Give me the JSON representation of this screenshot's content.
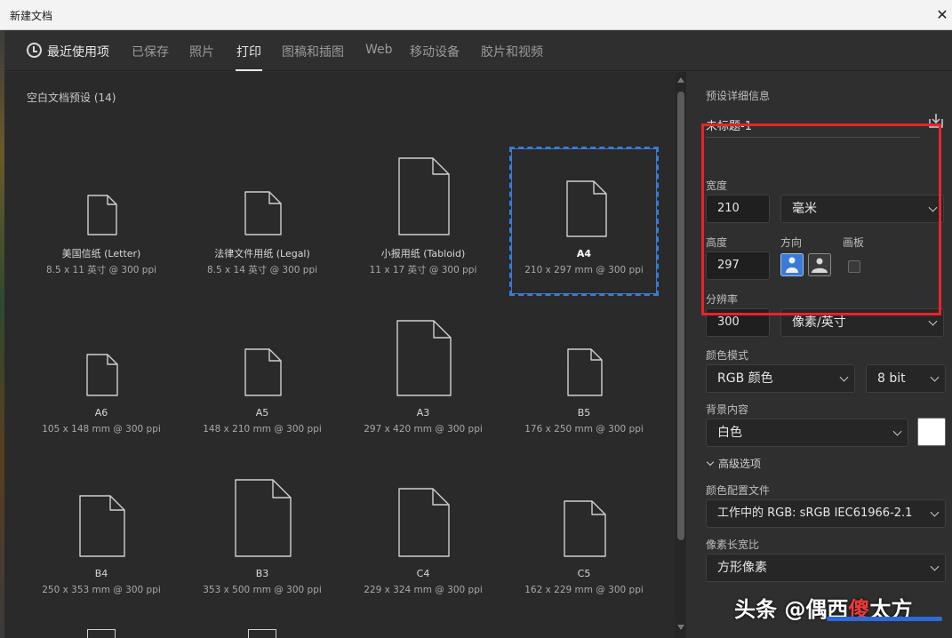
{
  "window": {
    "title": "新建文档",
    "close_glyph": "✕"
  },
  "tabs": [
    {
      "label": "最近使用项",
      "icon": "clock-icon"
    },
    {
      "label": "已保存"
    },
    {
      "label": "照片"
    },
    {
      "label": "打印",
      "active": true
    },
    {
      "label": "图稿和插图"
    },
    {
      "label": "Web"
    },
    {
      "label": "移动设备"
    },
    {
      "label": "胶片和视频"
    }
  ],
  "presets_panel": {
    "header": "空白文档预设 (14)",
    "items": [
      {
        "name": "美国信纸 (Letter)",
        "dims": "8.5 x 11 英寸 @ 300 ppi"
      },
      {
        "name": "法律文件用纸 (Legal)",
        "dims": "8.5 x 14 英寸 @ 300 ppi"
      },
      {
        "name": "小报用纸 (Tabloid)",
        "dims": "11 x 17 英寸 @ 300 ppi"
      },
      {
        "name": "A4",
        "dims": "210 x 297 mm @ 300 ppi",
        "selected": true
      },
      {
        "name": "A6",
        "dims": "105 x 148 mm @ 300 ppi"
      },
      {
        "name": "A5",
        "dims": "148 x 210 mm @ 300 ppi"
      },
      {
        "name": "A3",
        "dims": "297 x 420 mm @ 300 ppi"
      },
      {
        "name": "B5",
        "dims": "176 x 250 mm @ 300 ppi"
      },
      {
        "name": "B4",
        "dims": "250 x 353 mm @ 300 ppi"
      },
      {
        "name": "B3",
        "dims": "353 x 500 mm @ 300 ppi"
      },
      {
        "name": "C4",
        "dims": "229 x 324 mm @ 300 ppi"
      },
      {
        "name": "C5",
        "dims": "162 x 229 mm @ 300 ppi"
      }
    ]
  },
  "details": {
    "section_title": "预设详细信息",
    "doc_name": "未标题-1",
    "width_label": "宽度",
    "width_value": "210",
    "unit_value": "毫米",
    "height_label": "高度",
    "height_value": "297",
    "orientation_label": "方向",
    "artboard_label": "画板",
    "resolution_label": "分辨率",
    "resolution_value": "300",
    "resolution_unit": "像素/英寸",
    "color_mode_label": "颜色模式",
    "color_mode_value": "RGB 颜色",
    "bit_depth_value": "8 bit",
    "background_label": "背景内容",
    "background_value": "白色",
    "background_color": "#ffffff",
    "advanced_label": "高级选项",
    "profile_label": "颜色配置文件",
    "profile_value": "工作中的 RGB: sRGB IEC61966-2.1",
    "pixel_aspect_label": "像素长宽比",
    "pixel_aspect_value": "方形像素"
  },
  "watermark": {
    "prefix": "头条 @偶西",
    "red": "傻",
    "suffix": "太方"
  },
  "colors": {
    "accent": "#3a7bd5",
    "highlight": "#e8232c",
    "orient_active": "#3a7bd5"
  }
}
